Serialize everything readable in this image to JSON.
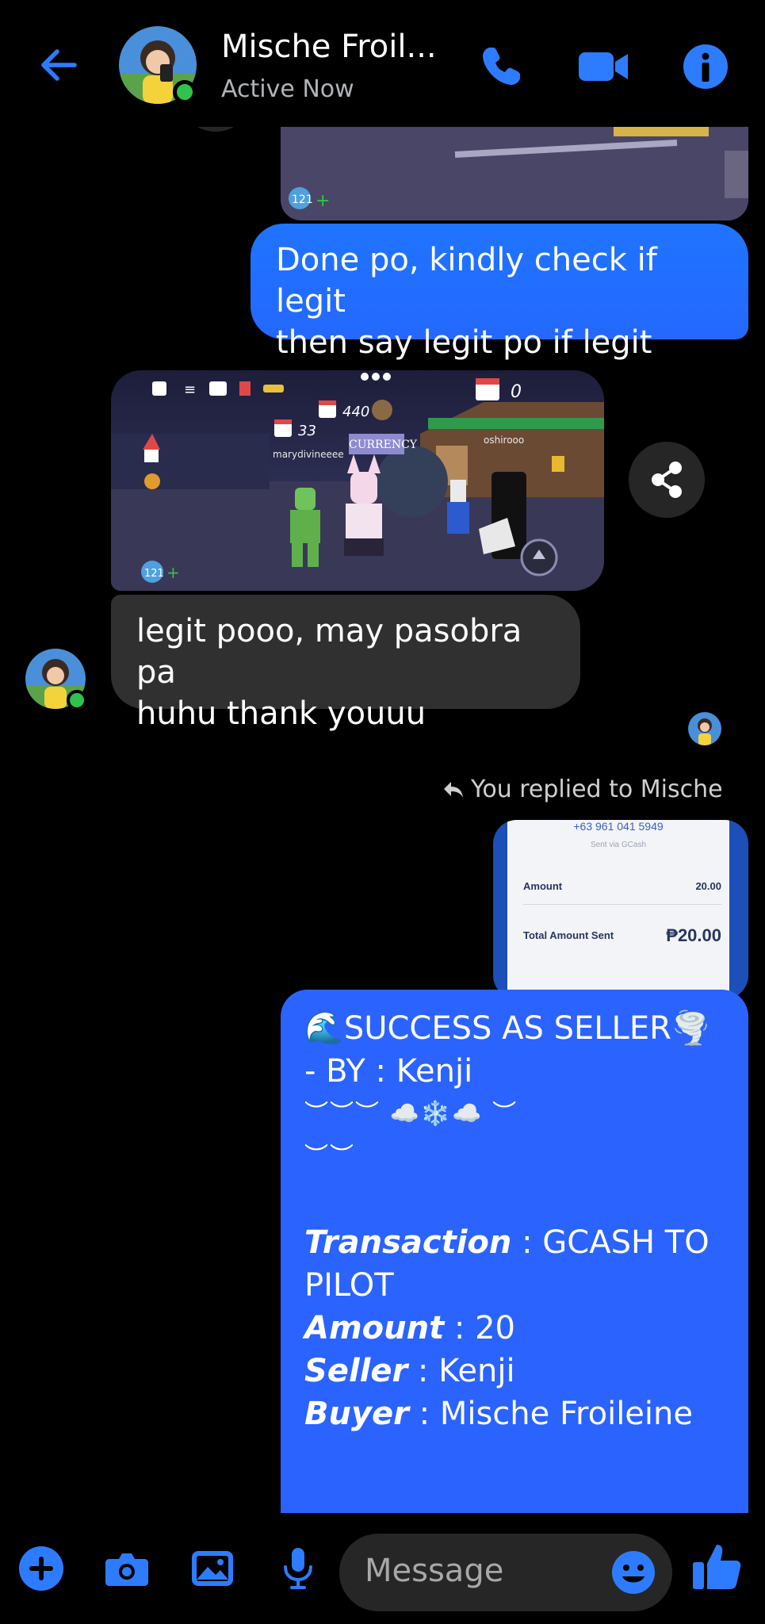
{
  "header": {
    "contact_name": "Mische Froil...",
    "status": "Active Now",
    "icons": [
      "back-arrow-icon",
      "phone-icon",
      "video-camera-icon",
      "info-icon"
    ]
  },
  "messages": {
    "out_1": {
      "line1": "Done po, kindly check if legit",
      "line2": "then say legit po if legit"
    },
    "in_1": {
      "line1": "legit pooo, may pasobra pa",
      "line2": "huhu thank youuu"
    },
    "game_screenshot": {
      "player_name": "marydivineeee",
      "other_player": "oshirooo",
      "stat_440": "440",
      "stat_33": "33",
      "stat_0": "0",
      "sign_text": "CURRENCY",
      "robux_badge": "121"
    },
    "reply_label": "You replied to Mische",
    "receipt": {
      "phone": "+63 961 041 5949",
      "sent_via": "Sent via GCash",
      "amount_label": "Amount",
      "amount_value": "20.00",
      "total_label": "Total Amount Sent",
      "total_value": "₱20.00"
    },
    "seller_card": {
      "title_line": "SUCCESS AS SELLER",
      "by_prefix": "- BY : ",
      "by_name": "Kenji",
      "deco_line1": "︶︶︶ ☁️❄️☁️ ︶",
      "deco_line2": "︶︶",
      "transaction_label": "Transaction",
      "transaction_value": " : GCASH TO",
      "transaction_value2": "PILOT",
      "amount_label": "Amount",
      "amount_value": " : 20",
      "seller_label": "Seller",
      "seller_value": " : Kenji",
      "buyer_label": "Buyer",
      "buyer_value": " : Mische Froileine"
    }
  },
  "composer": {
    "placeholder": "Message",
    "icons": [
      "plus-icon",
      "camera-icon",
      "gallery-icon",
      "microphone-icon",
      "emoji-icon",
      "thumbs-up-icon"
    ]
  },
  "colors": {
    "accent": "#1f74ff",
    "bubble_out": "#2468ff",
    "bubble_in": "#303030",
    "online": "#31c24d",
    "background": "#000000"
  }
}
